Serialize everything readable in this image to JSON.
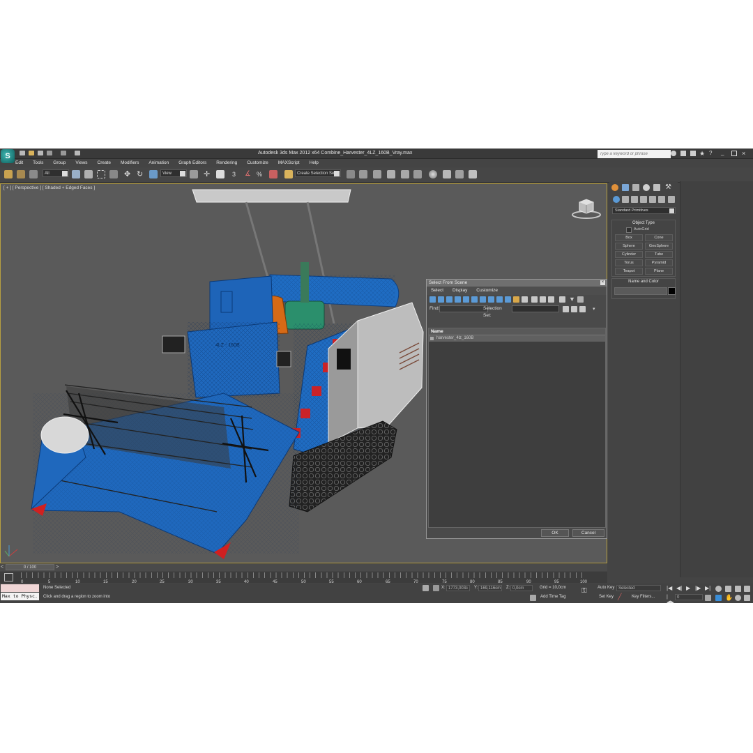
{
  "app": {
    "title": "Autodesk 3ds Max  2012 x64     Combine_Harvester_4LZ_160B_Vray.max",
    "search_placeholder": "Type a keyword or phrase",
    "logo_glyph": "S"
  },
  "menu": [
    "Edit",
    "Tools",
    "Group",
    "Views",
    "Create",
    "Modifiers",
    "Animation",
    "Graph Editors",
    "Rendering",
    "Customize",
    "MAXScript",
    "Help"
  ],
  "toolbar": {
    "filter_value": "All",
    "ref_coord_value": "View",
    "selection_set_value": "Create Selection Se"
  },
  "viewport": {
    "label": "[ + ] [ Perspective ] [ Shaded + Edged Faces ]",
    "model_labels": [
      "4LZ - 160B"
    ]
  },
  "dialog": {
    "title": "Select From Scene",
    "menu": [
      "Select",
      "Display",
      "Customize"
    ],
    "find_label": "Find:",
    "selection_set_label": "Selection Set:",
    "column_name": "Name",
    "rows": [
      "harvester_4lz_160B"
    ],
    "ok_label": "OK",
    "cancel_label": "Cancel"
  },
  "command_panel": {
    "category_value": "Standard Primitives",
    "object_type_title": "Object Type",
    "autogrid_label": "AutoGrid",
    "buttons": [
      "Box",
      "Cone",
      "Sphere",
      "GeoSphere",
      "Cylinder",
      "Tube",
      "Torus",
      "Pyramid",
      "Teapot",
      "Plane"
    ],
    "name_color_title": "Name and Color",
    "object_color": "#000000"
  },
  "timeline": {
    "slider_label": "0 / 100",
    "ticks": [
      "0",
      "5",
      "10",
      "15",
      "20",
      "25",
      "30",
      "35",
      "40",
      "45",
      "50",
      "55",
      "60",
      "65",
      "70",
      "75",
      "80",
      "85",
      "90",
      "95",
      "100"
    ]
  },
  "status": {
    "maxscript_text": "Max to Physc.",
    "selection_status": "None Selected",
    "prompt": "Click and drag a region to zoom into",
    "x_label": "X:",
    "x_value": "1773,003c",
    "y_label": "Y:",
    "y_value": "169,116cm",
    "z_label": "Z:",
    "z_value": "0,0cm",
    "grid": "Grid = 10,0cm",
    "add_time_tag": "Add Time Tag",
    "auto_key": "Auto Key",
    "set_key": "Set Key",
    "selected_value": "Selected",
    "key_filters": "Key Filters...",
    "frame_value": "0"
  },
  "colors": {
    "harvester_blue": "#1e64b8",
    "accent_teal": "#2b8f8c",
    "viewport_bg": "#5a5a5a",
    "dialog_selected_row": "#606060"
  }
}
